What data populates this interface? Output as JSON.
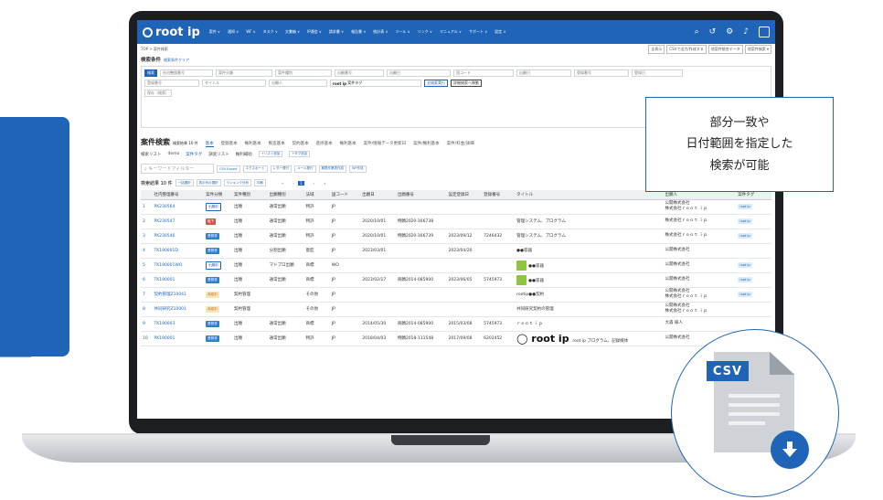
{
  "app": {
    "logo_text": "root ip",
    "menu": [
      "案件 ∨",
      "通知 ∨",
      "WF ∨",
      "タスク ∨",
      "文書箱 ∨",
      "IP通信 ∨",
      "請求書 ∨",
      "報告書 ∨",
      "統計表 ∨",
      "ツール ∨",
      "リンク ∨",
      "マニュアル ∨",
      "サポート ∨",
      "設定 ∨"
    ],
    "notification_count": "3"
  },
  "breadcrumb": "TOP > 案件検索",
  "top_buttons": [
    "全表示",
    "CSVで出力/作成する",
    "他案件統合データ",
    "他案件検索 ▾"
  ],
  "search": {
    "title": "検索条件",
    "title_link": "検索条件クリア",
    "row1": [
      "検索",
      "社内整理番号",
      "案件分類",
      "案件種別",
      "出願番号",
      "出願日",
      "国コード",
      "出願日",
      "登録番号",
      "登録日"
    ],
    "row2": [
      "登録番号",
      "タイトル",
      "出願人"
    ],
    "tag_label": "root ip",
    "tag_value": "案件タグ",
    "search_button": "全検索実行",
    "detail_button": "詳細検索へ移動",
    "save_button": "保存（検索）"
  },
  "results": {
    "title": "案件検索",
    "count_label": "検索結果 10 件",
    "tabs": [
      "基本",
      "登録基本",
      "権利基本",
      "製造基本",
      "契約基本",
      "進捗基本",
      "権利基本",
      "案件/情報データ更新日",
      "案件/権利基本",
      "案件/料金/詳細"
    ],
    "subtabs": [
      "検索リスト",
      "demo",
      "案件タグ",
      "調査リスト",
      "権利補助"
    ],
    "subtab_chips": [
      "+リスト追加",
      "+タグ追加"
    ],
    "filter_placeholder": "キーワードフィルター",
    "filter_buttons": [
      "CSV Export",
      "エクスポート",
      "レター発行",
      "メール発行",
      "期限作業表作成",
      "WF作成"
    ],
    "row_count": "検索結果 10 件",
    "action_buttons": [
      "一括選択",
      "表示列の選択",
      "ランキング分析",
      "印刷"
    ],
    "pages": [
      "«",
      "‹",
      "1",
      "›",
      "»"
    ],
    "current_page": "1",
    "columns": [
      "社内整理番号",
      "案件分類",
      "案件種別",
      "出願種別",
      "法域",
      "国コード",
      "出願日",
      "出願番号",
      "設定登録日",
      "登録番号",
      "タイトル",
      "出願人",
      "案件タグ"
    ],
    "rows": [
      {
        "num": "1",
        "id": "PK230564",
        "badge": "出願前",
        "badge_class": "b-out",
        "kind": "出願",
        "ft": "通常出願",
        "law": "特許",
        "cc": "JP",
        "fdate": "",
        "fno": "",
        "sdate": "",
        "rno": "",
        "title": "",
        "app1": "公開株式会社",
        "app2": "株式会社ｒｏｏｔ ｉｐ",
        "tag": "root ip"
      },
      {
        "num": "2",
        "id": "PK230547",
        "badge": "取下",
        "badge_class": "b-red",
        "kind": "出願",
        "ft": "通常出願",
        "law": "特許",
        "cc": "JP",
        "fdate": "2020/10/01",
        "fno": "特願2020-166738",
        "sdate": "",
        "rno": "",
        "title": "管理システム、プログラム",
        "app1": "株式会社ｒｏｏｔ ｉｐ",
        "app2": "",
        "tag": "root ip"
      },
      {
        "num": "3",
        "id": "PK230546",
        "badge": "登録済",
        "badge_class": "b-blue",
        "kind": "出願",
        "ft": "通常出願",
        "law": "特許",
        "cc": "JP",
        "fdate": "2020/10/01",
        "fno": "特願2020-166739",
        "sdate": "2023/09/12",
        "rno": "7246432",
        "title": "管理システム、プログラム",
        "app1": "株式会社ｒｏｏｔ ｉｐ",
        "app2": "",
        "tag": "root ip"
      },
      {
        "num": "4",
        "id": "TK190001D",
        "badge": "登録済",
        "badge_class": "b-blue",
        "kind": "出願",
        "ft": "分割出願",
        "law": "意匠",
        "cc": "JP",
        "fdate": "2023/03/01",
        "fno": "",
        "sdate": "2023/04/20",
        "rno": "",
        "title": "●●容器",
        "app1": "公開株式会社",
        "app2": "",
        "tag": ""
      },
      {
        "num": "5",
        "id": "TK190001WO",
        "badge": "出願前",
        "badge_class": "b-out",
        "kind": "出願",
        "ft": "マドプロ出願",
        "law": "商標",
        "cc": "WO",
        "fdate": "",
        "fno": "",
        "sdate": "",
        "rno": "",
        "title": "●●容器",
        "app1": "公開株式会社",
        "app2": "",
        "tag": "root ip"
      },
      {
        "num": "6",
        "id": "TK190001",
        "badge": "登録済",
        "badge_class": "b-blue",
        "kind": "出願",
        "ft": "通常出願",
        "law": "商標",
        "cc": "JP",
        "fdate": "2023/02/17",
        "fno": "商願2014-085900",
        "sdate": "2023/06/05",
        "rno": "5745973",
        "title": "●●容器",
        "app1": "公開株式会社",
        "app2": "",
        "tag": "root ip"
      },
      {
        "num": "7",
        "id": "契約管理Z10041",
        "badge": "対応中",
        "badge_class": "b-orange",
        "kind": "契約管理",
        "ft": "",
        "law": "その他",
        "cc": "JP",
        "fdate": "",
        "fno": "",
        "sdate": "",
        "rno": "",
        "title": "rootip●●契約",
        "app1": "公開株式会社",
        "app2": "株式会社ｒｏｏｔ ｉｐ",
        "tag": "root ip"
      },
      {
        "num": "8",
        "id": "共同研究Z10001",
        "badge": "対応中",
        "badge_class": "b-orange",
        "kind": "契約管理",
        "ft": "",
        "law": "その他",
        "cc": "JP",
        "fdate": "",
        "fno": "",
        "sdate": "",
        "rno": "",
        "title": "共同研究契約の管理",
        "app1": "公開株式会社",
        "app2": "株式会社ｒｏｏｔ ｉｐ",
        "tag": ""
      },
      {
        "num": "9",
        "id": "TK190003",
        "badge": "登録済",
        "badge_class": "b-blue",
        "kind": "出願",
        "ft": "通常出願",
        "law": "商標",
        "cc": "JP",
        "fdate": "2014/05/30",
        "fno": "商願2014-085900",
        "sdate": "2015/03/08",
        "rno": "5745973",
        "title": "ｒｏｏｔ ｉｐ",
        "app1": "大森 様人",
        "app2": "",
        "tag": ""
      },
      {
        "num": "10",
        "id": "PK190001",
        "badge": "登録済",
        "badge_class": "b-blue",
        "kind": "出願",
        "ft": "通常出願",
        "law": "特許",
        "cc": "JP",
        "fdate": "2018/04/03",
        "fno": "特願2018-111548",
        "sdate": "2017/09/08",
        "rno": "6202452",
        "title": "root ip プログラム、記録媒体",
        "app1": "公開株式会社",
        "app2": "",
        "tag": ""
      }
    ]
  },
  "callout": {
    "lines": [
      "部分一致や",
      "日付範囲を指定した",
      "検索が可能"
    ]
  },
  "csv_icon": {
    "label": "CSV"
  },
  "colors": {
    "primary": "#1f64b6"
  }
}
